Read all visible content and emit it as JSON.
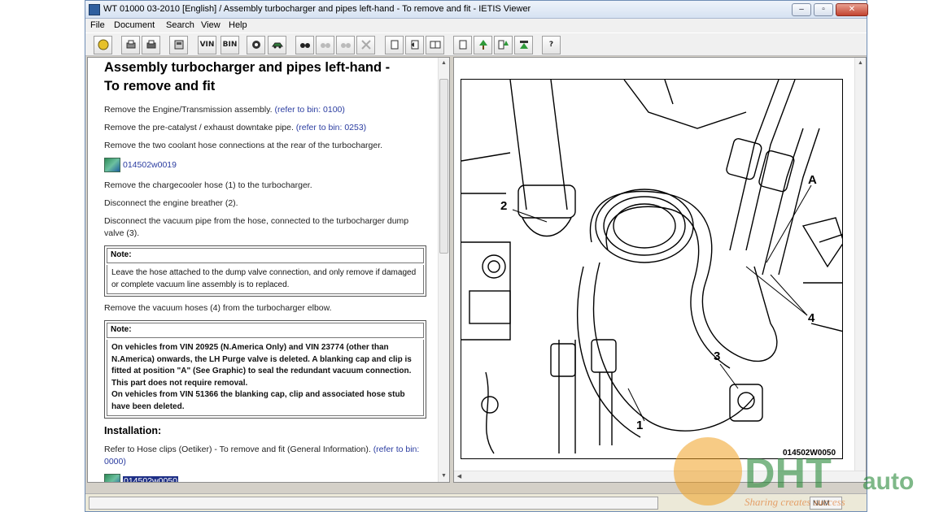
{
  "window": {
    "title": "WT 01000 03-2010 [English] / Assembly turbocharger and pipes left-hand - To remove and fit - IETIS Viewer",
    "minimize_label": "–",
    "maximize_label": "▫",
    "close_label": "✕"
  },
  "menu": {
    "file": "File",
    "document": "Document",
    "search": "Search",
    "view": "View",
    "help": "Help"
  },
  "toolbar": {
    "vin_label": "VIN",
    "bin_label": "BIN",
    "help_label": "?"
  },
  "doc": {
    "title_line1": "Assembly turbocharger and pipes left-hand -",
    "title_line2": "To remove and fit",
    "step1_text": "Remove the Engine/Transmission assembly. ",
    "step1_link": "(refer to bin: 0100)",
    "step2_text": "Remove the pre-catalyst / exhaust downtake pipe. ",
    "step2_link": "(refer to bin: 0253)",
    "step3_text": "Remove the two coolant hose connections at the rear of the turbocharger.",
    "image1_link": "014502w0019",
    "step4_text": "Remove the chargecooler hose (1) to the turbocharger.",
    "step5_text": "Disconnect the engine breather (2).",
    "step6_text": "Disconnect the vacuum pipe from the hose, connected to the turbocharger dump valve (3).",
    "note1_head": "Note:",
    "note1_body": "Leave the hose attached to the dump valve connection, and only remove if damaged or complete vacuum line assembly is to replaced.",
    "step7_text": "Remove the vacuum hoses (4) from the turbocharger elbow.",
    "note2_head": "Note:",
    "note2_body_1": "On vehicles from VIN 20925 (N.America Only) and VIN 23774 (other than N.America) onwards, the LH Purge valve is deleted. A blanking cap and clip is fitted at position \"A\" (See Graphic) to seal the redundant vacuum connection. This part does not require removal.",
    "note2_body_2": "On vehicles from VIN 51366 the blanking cap, clip and associated hose stub have been deleted.",
    "installation_heading": "Installation:",
    "install_step1_text": "Refer to Hose clips (Oetiker) - To remove and fit (General Information). ",
    "install_step1_link": "(refer to bin: 0000)",
    "image2_link": "014502w0050"
  },
  "diagram": {
    "callout_1": "1",
    "callout_2": "2",
    "callout_3": "3",
    "callout_4": "4",
    "callout_a": "A",
    "figure_code": "014502W0050"
  },
  "statusbar": {
    "num": "NUM"
  },
  "watermark": {
    "brand": "DHT auto",
    "tagline": "Sharing creates success"
  },
  "colors": {
    "link": "#2a3ca0",
    "selection": "#1e2f86",
    "close_button": "#c24431"
  }
}
